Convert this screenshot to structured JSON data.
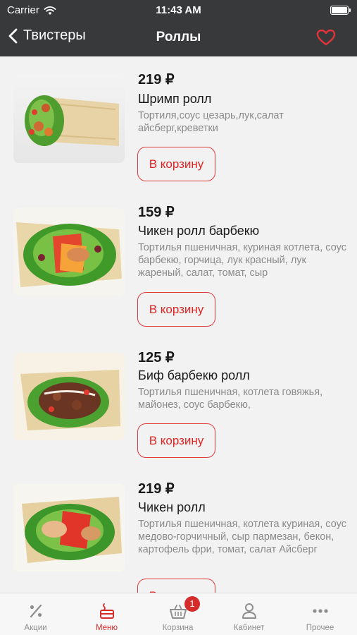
{
  "status_bar": {
    "carrier": "Carrier",
    "time": "11:43 AM"
  },
  "nav": {
    "back_label": "Твистеры",
    "title": "Роллы"
  },
  "products": [
    {
      "price": "219 ₽",
      "name": "Шримп ролл",
      "description": "Тортиля,соус цезарь,лук,салат айсберг,креветки",
      "button": "В корзину"
    },
    {
      "price": "159 ₽",
      "name": "Чикен ролл барбекю",
      "description": "Тортилья пшеничная, куриная котлета, соус барбекю, горчица, лук красный, лук жареный, салат, томат, сыр",
      "button": "В корзину"
    },
    {
      "price": "125 ₽",
      "name": "Биф барбекю ролл",
      "description": "Тортилья пшеничная, котлета говяжья, майонез, соус барбекю,",
      "button": "В корзину"
    },
    {
      "price": "219 ₽",
      "name": "Чикен ролл",
      "description": "Тортилья пшеничная, котлета куриная, соус медово-горчичный, сыр пармезан, бекон, картофель фри, томат, салат Айсберг",
      "button": "В корзину"
    }
  ],
  "tab_bar": {
    "active": "Меню",
    "cart_badge": "1",
    "tabs": [
      {
        "label": "Акции",
        "icon": "percent-icon"
      },
      {
        "label": "Меню",
        "icon": "food-tray-icon"
      },
      {
        "label": "Корзина",
        "icon": "basket-icon"
      },
      {
        "label": "Кабинет",
        "icon": "user-icon"
      },
      {
        "label": "Прочее",
        "icon": "more-dots-icon"
      }
    ]
  },
  "colors": {
    "accent": "#d62b2b",
    "header": "#38393b"
  }
}
